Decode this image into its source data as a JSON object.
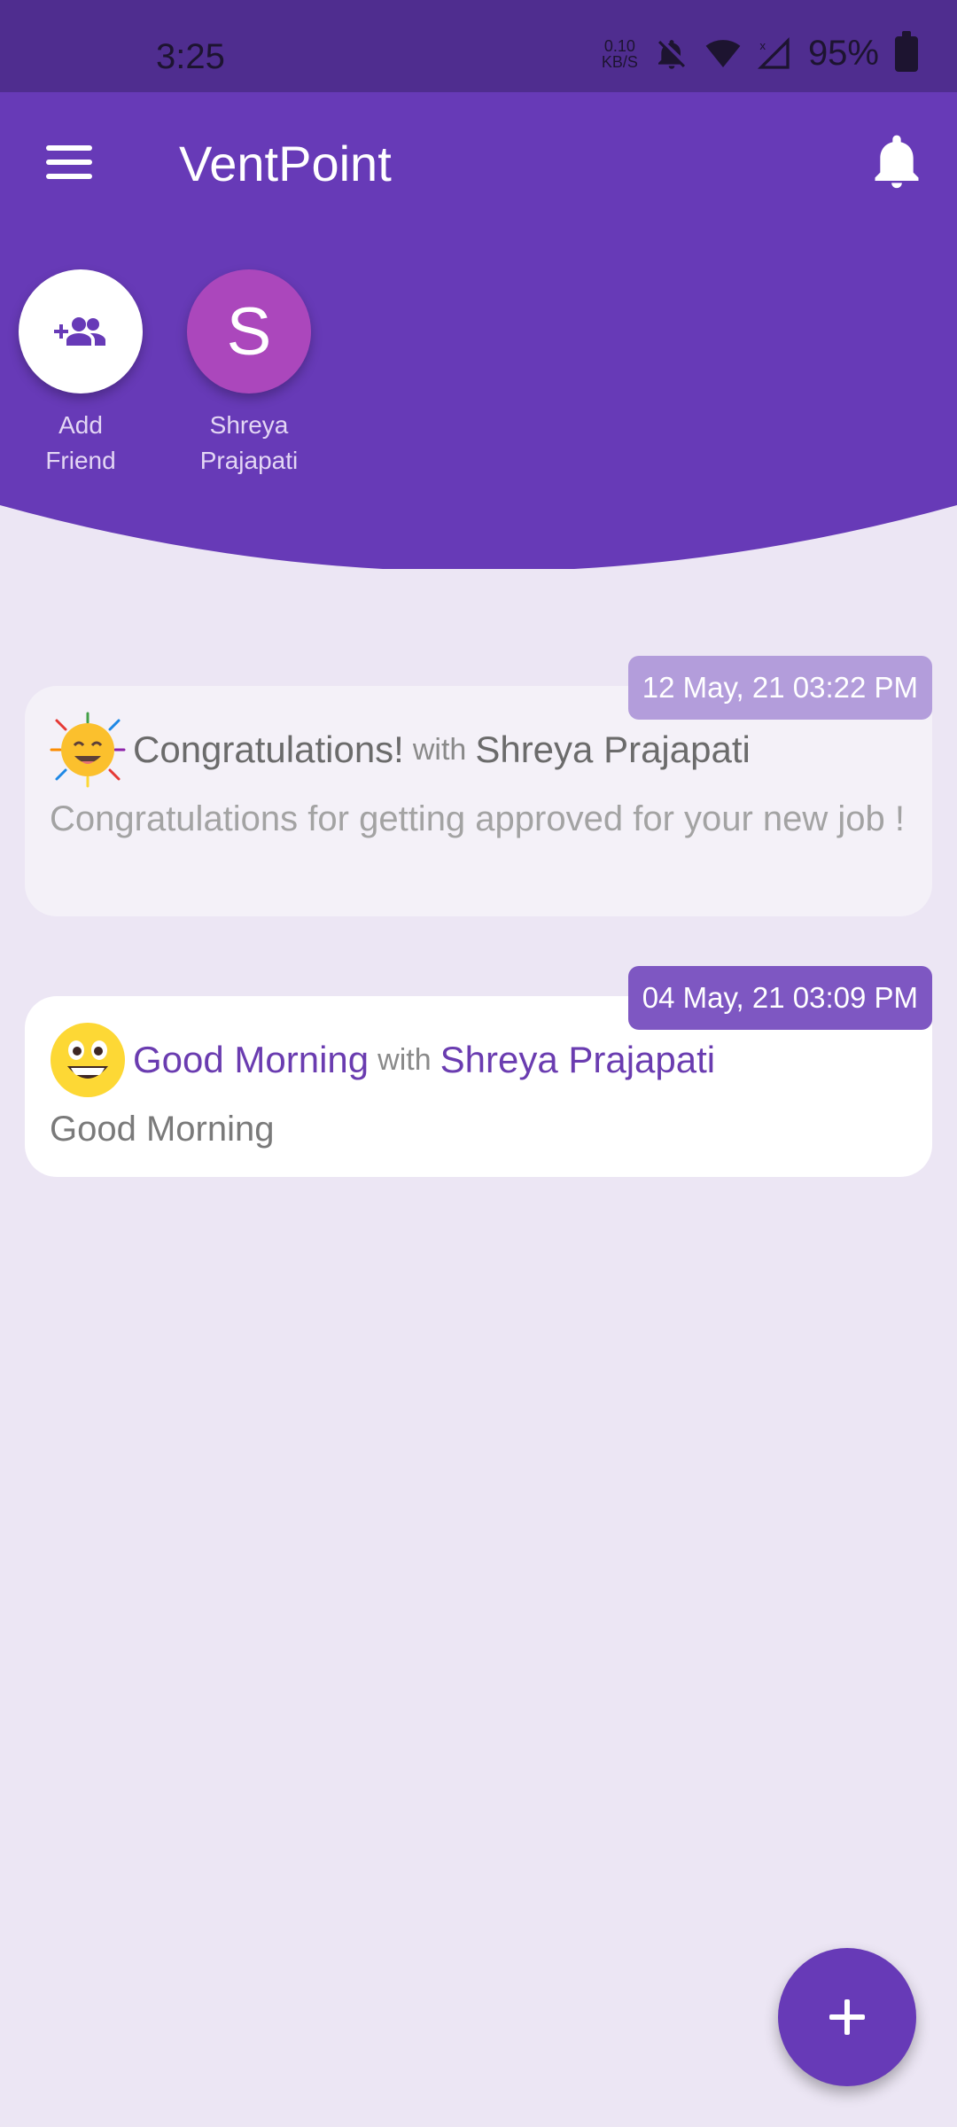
{
  "status_bar": {
    "time": "3:25",
    "net_speed_value": "0.10",
    "net_speed_unit": "KB/S",
    "battery_percent": "95%"
  },
  "app_bar": {
    "title": "VentPoint",
    "menu_icon": "hamburger-menu-icon",
    "notification_icon": "bell-icon"
  },
  "friends": {
    "add": {
      "line1": "Add",
      "line2": "Friend",
      "icon": "add-person-icon"
    },
    "items": [
      {
        "initial": "S",
        "line1": "Shreya",
        "line2": "Prajapati"
      }
    ]
  },
  "posts": [
    {
      "date": "12 May, 21 03:22 PM",
      "emoji": "partying-face-emoji",
      "title": "Congratulations!",
      "with": "with",
      "person": "Shreya Prajapati",
      "message": "Congratulations for getting approved for your new job !"
    },
    {
      "date": "04 May, 21 03:09 PM",
      "emoji": "grinning-face-emoji",
      "title": "Good Morning",
      "with": "with",
      "person": "Shreya Prajapati",
      "message": "Good Morning"
    }
  ],
  "fab": {
    "icon": "plus-icon"
  },
  "colors": {
    "primary": "#673ab7",
    "status_bar": "#4f2d8f",
    "background": "#ece6f4",
    "avatar": "#ab47bc",
    "badge_light": "#b39ddb",
    "badge_dark": "#7e57c2"
  }
}
